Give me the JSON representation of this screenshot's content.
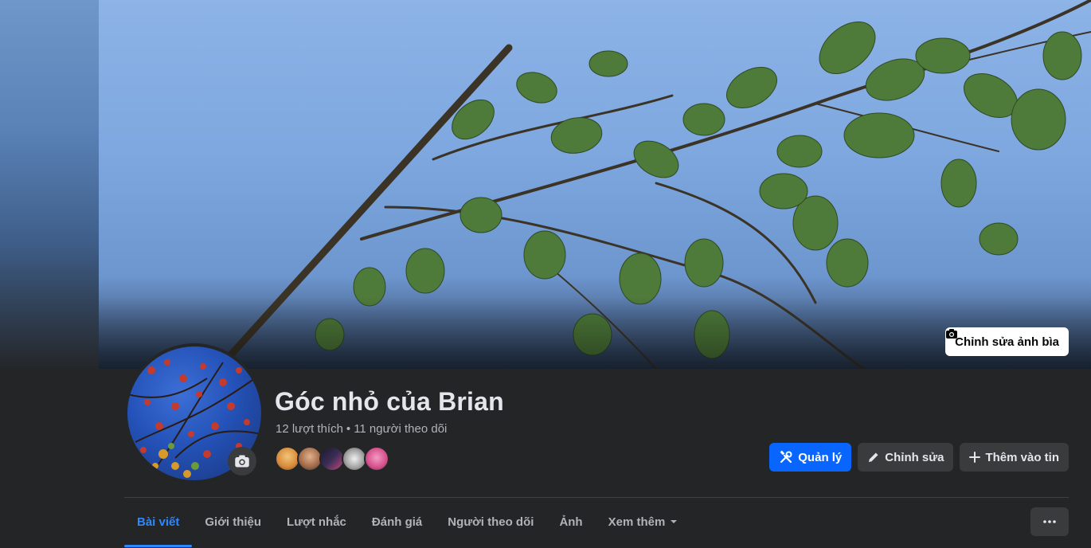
{
  "cover": {
    "edit_label": "Chỉnh sửa ảnh bìa",
    "icon": "camera-icon"
  },
  "profile": {
    "name": "Góc nhỏ của Brian",
    "likes": "12 lượt thích",
    "separator": "•",
    "followers": "11 người theo dõi",
    "avatar_camera_icon": "camera-icon"
  },
  "friends": [
    {
      "name": "friend-1",
      "color": "#e8a84c"
    },
    {
      "name": "friend-2",
      "color": "#c98f6a"
    },
    {
      "name": "friend-3",
      "color": "#2a2340"
    },
    {
      "name": "friend-4",
      "color": "#bdbdbd"
    },
    {
      "name": "friend-5",
      "color": "#e86aa8"
    }
  ],
  "actions": {
    "manage": {
      "label": "Quản lý",
      "icon": "tools-icon"
    },
    "edit": {
      "label": "Chỉnh sửa",
      "icon": "pencil-icon"
    },
    "add_story": {
      "label": "Thêm vào tin",
      "icon": "plus-icon"
    }
  },
  "tabs": [
    {
      "label": "Bài viết",
      "active": true
    },
    {
      "label": "Giới thiệu",
      "active": false
    },
    {
      "label": "Lượt nhắc",
      "active": false
    },
    {
      "label": "Đánh giá",
      "active": false
    },
    {
      "label": "Người theo dõi",
      "active": false
    },
    {
      "label": "Ảnh",
      "active": false
    },
    {
      "label": "Xem thêm",
      "active": false,
      "icon": "caret-down-icon"
    }
  ],
  "more_menu": {
    "icon": "ellipsis-icon"
  },
  "colors": {
    "accent": "#0866ff",
    "tab_active": "#2d88ff",
    "background": "#18191a",
    "surface": "#242526"
  }
}
